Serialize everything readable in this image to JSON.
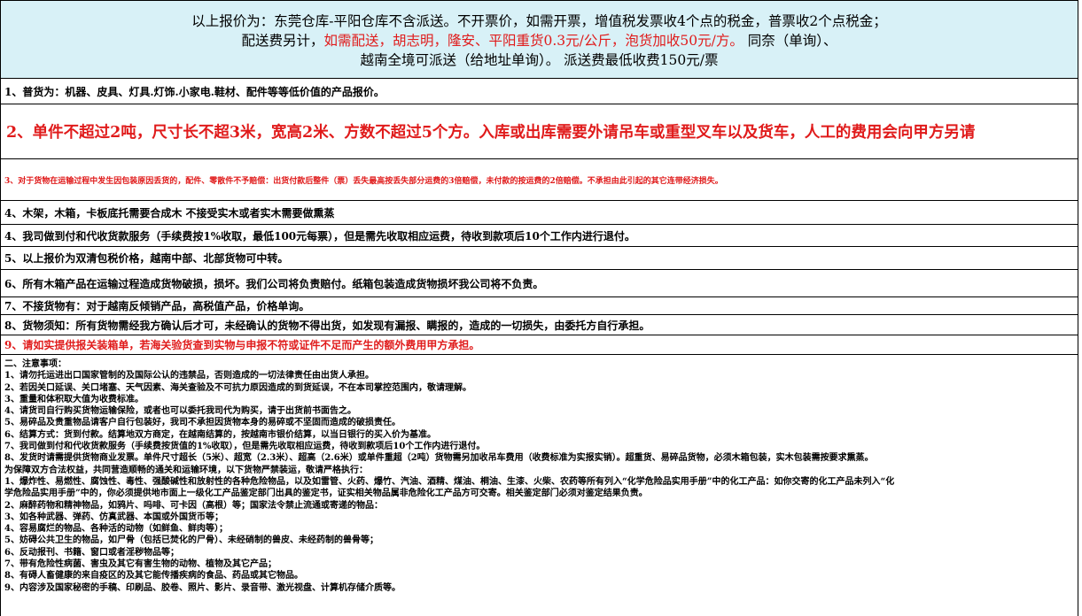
{
  "header": {
    "line1": "以上报价为：东莞仓库-平阳仓库不含派送。不开票价，如需开票，增值税发票收4个点的税金，普票收2个点税金；",
    "line2_a": "配送费另计，",
    "line2_red": "如需配送，胡志明，隆安、平阳重货0.3元/公斤，泡货加收50元/方。",
    "line2_b": " 同奈（单询）、",
    "line3": "越南全境可派送（给地址单询）。 派送费最低收费150元/票"
  },
  "rows": {
    "r1": "1、普货为：机器、皮具、灯具.灯饰.小家电.鞋材、配件等等低价值的产品报价。",
    "r2": "2、单件不超过2吨，尺寸长不超3米，宽高2米、方数不超过5个方。入库或出库需要外请吊车或重型叉车以及货车，人工的费用会向甲方另请",
    "r3": "3、对于货物在运输过程中发生因包装原因丢货的，配件、零散件不予赔偿：出货付款后整件（票）丢失最高按丢失部分运费的3倍赔偿，未付款的按运费的2倍赔偿。不承担由此引起的其它连带经济损失。",
    "r4": "4、木架，木箱，卡板底托需要合成木  不接受实木或者实木需要做熏蒸",
    "r5": "4、我司做到付和代收货款服务（手续费按1%收取，最低100元每票），但是需先收取相应运费，待收到款项后10个工作内进行退付。",
    "r6": "5、以上报价为双清包税价格，越南中部、北部货物可中转。",
    "r7": "6、所有木箱产品在运输过程造成货物破损，损坏。我们公司将负责赔付。纸箱包装造成货物损坏我公司将不负责。",
    "r8": "7、不接货物有：对于越南反倾销产品，高税值产品，价格单询。",
    "r9": "8、货物须知：所有货物需经我方确认后才可，未经确认的货物不得出货，如发现有漏报、瞒报的，造成的一切损失，由委托方自行承担。",
    "r10": "9、请如实提供报关装箱单，若海关验货查到实物与申报不符或证件不足而产生的额外费用甲方承担。"
  },
  "notes": [
    "二、注意事项：",
    "1、请勿托运进出口国家管制的及国际公认的违禁品，否则造成的一切法律责任由出货人承担。",
    "2、若因关口延误、关口堵塞、天气因素、海关查验及不可抗力原因造成的到货延误，不在本司掌控范围内，敬请理解。",
    "3、重量和体积取大值为收费标准。",
    "4、请货司自行购买货物运输保险，或者也可以委托我司代为购买，请于出货前书面告之。",
    "5、易碎品及贵重物品请客户自行包装好，我司不承担因货物本身的易碎或不坚固而造成的破损责任。",
    "6、结算方式：货到付款。结算地双方商定，在越南结算的，按越南市银价结算，以当日银行的买入价为基准。",
    "7、我司做到付和代收货款服务（手续费按货值的1%收取），但是需先收取相应运费，待收到款项后10个工作内进行退付。",
    "8、发货时请需提供货物商业发票。单件尺寸超长（5米）、超宽（2.3米）、超高（2.6米）或单件重超（2吨）货物需另加收吊车费用（收费标准为实报实销）。超重货、易碎品货物，必须木箱包装，实木包装需按要求熏蒸。",
    "为保障双方合法权益，共同营造顺畅的通关和运输环境，以下货物严禁装运，敬请严格执行：",
    "1、爆炸性、易燃性、腐蚀性、毒性、强酸碱性和放射性的各种危险物品，以及如雷管、火药、爆竹、汽油、酒精、煤油、桐油、生漆、火柴、农药等所有列入“化学危险品实用手册”中的化工产品：如你交寄的化工产品未列入“化",
    "学危险品实用手册”中的，你必须提供地市面上一级化工产品鉴定部门出具的鉴定书，证实相关物品属非危险化工产品方可交寄。相关鉴定部门必须对鉴定结果负责。",
    "2、麻醉药物和精神物品，如鸦片、吗啡、可卡因（高根）等；国家法令禁止流通或寄递的物品：",
    "3、如各种武器、弹药、仿真武器、本国或外国货币等；",
    "4、容易腐烂的物品、各种活的动物（如鲜鱼、鲜肉等）；",
    "5、妨碍公共卫生的物品，如尸骨（包括已焚化的尸骨）、未经硝制的兽皮、未经药制的兽骨等；",
    "6、反动报刊、书籍、窗口或者淫秽物品等；",
    "7、带有危险性病菌、害虫及其它有害生物的动物、植物及其它产品；",
    "8、有碍人畜健康的来自疫区的及其它能传播疾病的食品、药品或其它物品。",
    "9、内容涉及国家秘密的手稿、印刷品、胶卷、照片、影片、录音带、激光视盘、计算机存储介质等。"
  ]
}
